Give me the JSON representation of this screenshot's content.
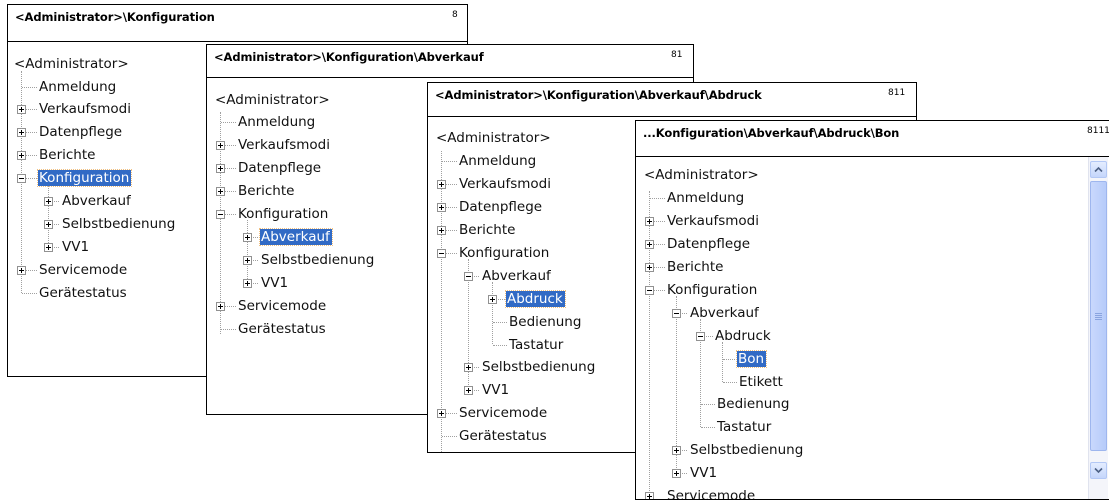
{
  "windows": [
    {
      "title": "<Administrator>\\Konfiguration",
      "code": "8",
      "nodes": {
        "root": "<Administrator>",
        "anmeldung": "Anmeldung",
        "verkaufsmodi": "Verkaufsmodi",
        "datenpflege": "Datenpflege",
        "berichte": "Berichte",
        "konfiguration": "Konfiguration",
        "abverkauf": "Abverkauf",
        "selbstbedienung": "Selbstbedienung",
        "vv1": "VV1",
        "servicemode": "Servicemode",
        "geraetestatus": "Gerätestatus"
      }
    },
    {
      "title": "<Administrator>\\Konfiguration\\Abverkauf",
      "code": "81",
      "nodes": {
        "root": "<Administrator>",
        "anmeldung": "Anmeldung",
        "verkaufsmodi": "Verkaufsmodi",
        "datenpflege": "Datenpflege",
        "berichte": "Berichte",
        "konfiguration": "Konfiguration",
        "abverkauf": "Abverkauf",
        "selbstbedienung": "Selbstbedienung",
        "vv1": "VV1",
        "servicemode": "Servicemode",
        "geraetestatus": "Gerätestatus"
      }
    },
    {
      "title": "<Administrator>\\Konfiguration\\Abverkauf\\Abdruck",
      "code": "811",
      "nodes": {
        "root": "<Administrator>",
        "anmeldung": "Anmeldung",
        "verkaufsmodi": "Verkaufsmodi",
        "datenpflege": "Datenpflege",
        "berichte": "Berichte",
        "konfiguration": "Konfiguration",
        "abverkauf": "Abverkauf",
        "abdruck": "Abdruck",
        "bedienung": "Bedienung",
        "tastatur": "Tastatur",
        "selbstbedienung": "Selbstbedienung",
        "vv1": "VV1",
        "servicemode": "Servicemode",
        "geraetestatus": "Gerätestatus"
      }
    },
    {
      "title": "...Konfiguration\\Abverkauf\\Abdruck\\Bon",
      "code": "8111",
      "nodes": {
        "root": "<Administrator>",
        "anmeldung": "Anmeldung",
        "verkaufsmodi": "Verkaufsmodi",
        "datenpflege": "Datenpflege",
        "berichte": "Berichte",
        "konfiguration": "Konfiguration",
        "abverkauf": "Abverkauf",
        "abdruck": "Abdruck",
        "bon": "Bon",
        "etikett": "Etikett",
        "bedienung": "Bedienung",
        "tastatur": "Tastatur",
        "selbstbedienung": "Selbstbedienung",
        "vv1": "VV1",
        "servicemode": "Servicemode"
      }
    }
  ],
  "colors": {
    "selection": "#316ac5",
    "border": "#000000",
    "scrollbar": "#c5d6fb"
  },
  "icons": [
    "expander-plus-icon",
    "expander-minus-icon",
    "scroll-up-arrow-icon",
    "scroll-down-arrow-icon"
  ]
}
